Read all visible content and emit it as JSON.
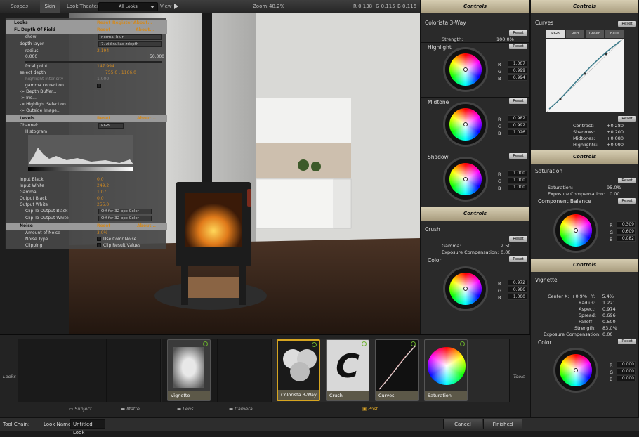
{
  "topbar": {
    "scopes_tab": "Scopes",
    "skin_tab": "Skin",
    "look_theater_label": "Look Theater",
    "look_theater_value": "All Looks",
    "view_label": "View",
    "zoom_label": "Zoom:",
    "zoom_value": "48.2%",
    "r_readout": "R 0.138",
    "g_readout": "G 0.115",
    "b_readout": "B 0.116"
  },
  "effects": {
    "looks_header": "Looks",
    "looks_reset": "Reset",
    "looks_register": "Register",
    "looks_about": "About...",
    "dof_header": "FL Depth Of Field",
    "dof_reset": "Reset",
    "dof_about": "About...",
    "show_label": "show",
    "show_value": "normal blur",
    "depth_layer_label": "depth layer",
    "depth_layer_value": "7. zidinukas zdepth",
    "radius_label": "radius",
    "radius_value": "2.194",
    "radius_min": "0.000",
    "radius_max": "50.000",
    "focal_point_label": "focal point",
    "focal_point_value": "147.994",
    "select_depth_label": "select depth",
    "select_depth_value": "755.0 , 1166.0",
    "highlight_intensity_label": "highlight intensity",
    "highlight_intensity_value": "1.000",
    "gamma_correction_label": "gamma correction",
    "depth_buffer_label": "-> Depth Buffer...",
    "iris_label": "-> Iris...",
    "highlight_selection_label": "-> Highlight Selection...",
    "outside_image_label": "-> Outside Image...",
    "levels_header": "Levels",
    "levels_reset": "Reset",
    "levels_about": "About...",
    "channel_label": "Channel:",
    "channel_value": "RGB",
    "histogram_label": "Histogram",
    "input_black_label": "Input Black",
    "input_black_value": "0.0",
    "input_white_label": "Input White",
    "input_white_value": "249.2",
    "gamma_label": "Gamma",
    "gamma_value": "1.07",
    "output_black_label": "Output Black",
    "output_black_value": "0.0",
    "output_white_label": "Output White",
    "output_white_value": "255.0",
    "clip_black_label": "Clip To Output Black",
    "clip_black_value": "Off for 32 bpc Color",
    "clip_white_label": "Clip To Output White",
    "clip_white_value": "Off for 32 bpc Color",
    "noise_header": "Noise",
    "noise_reset": "Reset",
    "noise_about": "About...",
    "amount_label": "Amount of Noise",
    "amount_value": "3.0%",
    "noise_type_label": "Noise Type",
    "noise_type_value": "Use Color Noise",
    "clipping_label": "Clipping",
    "clipping_value": "Clip Result Values"
  },
  "colorista": {
    "header": "Controls",
    "title": "Colorista 3-Way",
    "reset": "Reset",
    "strength_label": "Strength:",
    "strength_value": "100.0%",
    "highlight_title": "Highlight",
    "highlight_r": "1.007",
    "highlight_g": "0.999",
    "highlight_b": "0.994",
    "midtone_title": "Midtone",
    "midtone_r": "0.982",
    "midtone_g": "0.992",
    "midtone_b": "1.026",
    "shadow_title": "Shadow",
    "shadow_r": "1.000",
    "shadow_g": "1.000",
    "shadow_b": "1.000",
    "r_label": "R",
    "g_label": "G",
    "b_label": "B"
  },
  "crush": {
    "header": "Controls",
    "title": "Crush",
    "reset": "Reset",
    "gamma_label": "Gamma:",
    "gamma_value": "2.50",
    "exposure_label": "Exposure Compensation:",
    "exposure_value": "0.00",
    "color_title": "Color",
    "r": "0.972",
    "g": "0.986",
    "b": "1.000"
  },
  "curves": {
    "header": "Controls",
    "title": "Curves",
    "reset": "Reset",
    "tabs": [
      "RGB",
      "Red",
      "Green",
      "Blue"
    ],
    "contrast_label": "Contrast:",
    "contrast_value": "+0.280",
    "shadows_label": "Shadows:",
    "shadows_value": "+0.200",
    "midtones_label": "Midtones:",
    "midtones_value": "+0.080",
    "highlights_label": "Highlights:",
    "highlights_value": "+0.090"
  },
  "saturation": {
    "header": "Controls",
    "title": "Saturation",
    "reset": "Reset",
    "saturation_label": "Saturation:",
    "saturation_value": "95.0%",
    "exposure_label": "Exposure Compensation:",
    "exposure_value": "0.00",
    "balance_title": "Component Balance",
    "r": "0.309",
    "g": "0.609",
    "b": "0.082"
  },
  "vignette": {
    "header": "Controls",
    "title": "Vignette",
    "reset": "Reset",
    "center_label": "Center X:",
    "center_x": "+0.9%",
    "center_y_label": "Y:",
    "center_y": "+5.4%",
    "radius_label": "Radius:",
    "radius_value": "1.221",
    "aspect_label": "Aspect:",
    "aspect_value": "0.974",
    "spread_label": "Spread:",
    "spread_value": "0.696",
    "falloff_label": "Falloff:",
    "falloff_value": "0.500",
    "strength_label": "Strength:",
    "strength_value": "83.0%",
    "exposure_label": "Exposure Compensation:",
    "exposure_value": "0.00",
    "color_title": "Color",
    "r": "0.000",
    "g": "0.000",
    "b": "0.000"
  },
  "toolchain": {
    "looks_label": "Looks",
    "tools_label": "Tools",
    "subject": "Subject",
    "matte": "Matte",
    "lens": "Lens",
    "camera": "Camera",
    "post": "Post",
    "vignette_tool": "Vignette",
    "colorista_tool": "Colorista 3-Way",
    "crush_tool": "Crush",
    "curves_tool": "Curves",
    "saturation_tool": "Saturation"
  },
  "status": {
    "tool_chain_label": "Tool Chain:",
    "look_name_label": "Look Name:",
    "look_name_value": "Untitled Look",
    "cancel": "Cancel",
    "finished": "Finished"
  },
  "colors": {
    "accent_orange": "#d08a23",
    "header_tan": "#c8bd9e",
    "power_green": "#6ab02b",
    "selected_tool": "#d6a520"
  }
}
